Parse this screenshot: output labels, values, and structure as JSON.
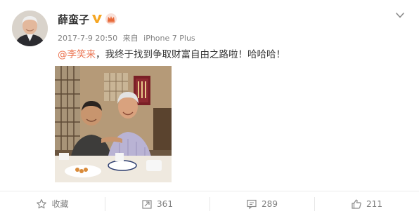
{
  "post": {
    "username": "薛蛮子",
    "timestamp": "2017-7-9 20:50",
    "source_prefix": "来自",
    "source": "iPhone 7 Plus",
    "mention": "@李笑来",
    "text": "，我终于找到争取财富自由之路啦！哈哈哈！",
    "icons": {
      "verified": "verified-v-icon",
      "member": "member-crown-icon",
      "menu": "chevron-down-icon"
    },
    "colors": {
      "mention": "#eb7350",
      "verified": "#f5a623",
      "meta": "#808080"
    }
  },
  "actions": {
    "favorite_label": "收藏",
    "repost_count": "361",
    "comment_count": "289",
    "like_count": "211"
  }
}
